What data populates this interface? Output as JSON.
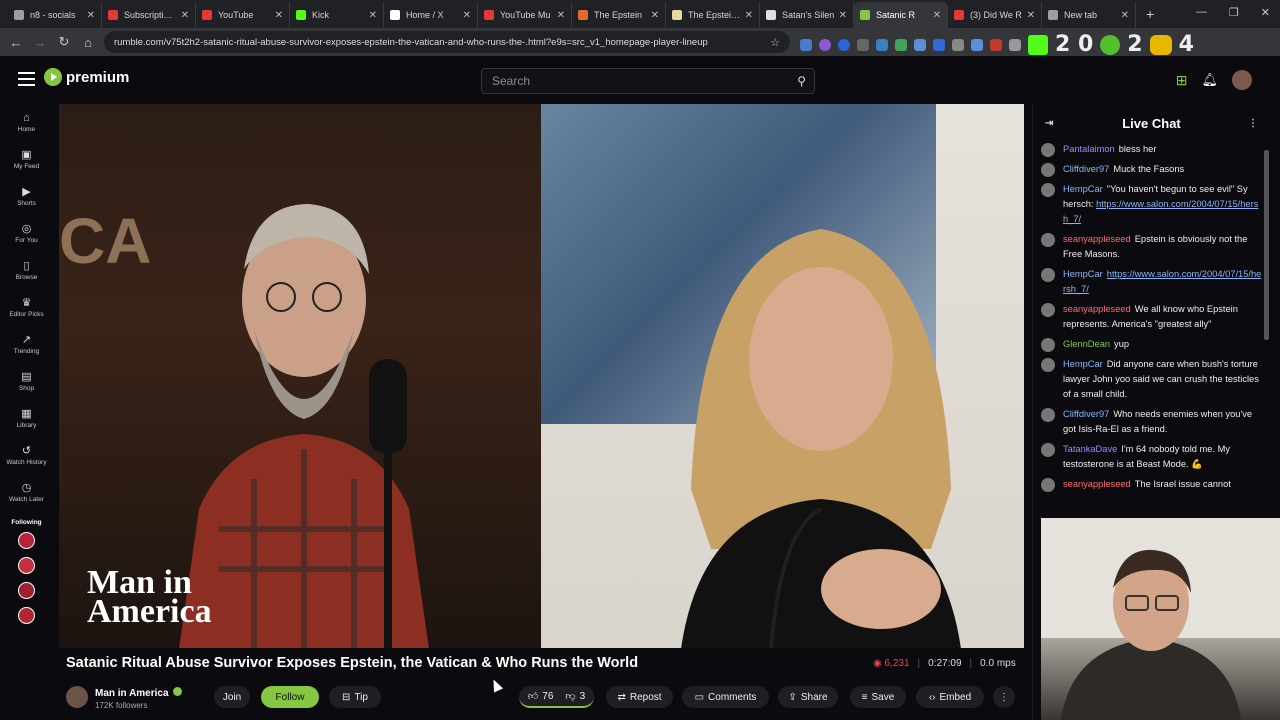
{
  "browser": {
    "tabs": [
      {
        "label": "n8 - socials",
        "color": "#9e9e9e"
      },
      {
        "label": "Subscriptions",
        "color": "#e53935"
      },
      {
        "label": "YouTube",
        "color": "#e53935"
      },
      {
        "label": "Kick",
        "color": "#53fc18"
      },
      {
        "label": "Home / X",
        "color": "#ffffff"
      },
      {
        "label": "YouTube Mu",
        "color": "#e53935"
      },
      {
        "label": "The Epstein",
        "color": "#e86a2a"
      },
      {
        "label": "The Epstein F",
        "color": "#e8d9a0"
      },
      {
        "label": "Satan's Silen",
        "color": "#e0e0e0"
      },
      {
        "label": "Satanic R",
        "color": "#85c742"
      },
      {
        "label": "(3) Did We R",
        "color": "#e53935"
      },
      {
        "label": "New tab",
        "color": "#9e9e9e"
      }
    ],
    "url": "rumble.com/v75t2h2-satanic-ritual-abuse-survivor-exposes-epstein-the-vatican-and-who-runs-the-.html?e9s=src_v1_homepage-player-lineup",
    "ext_text_1": "2 0",
    "ext_text_2": "2",
    "ext_text_3": "4"
  },
  "header": {
    "logo_text": "premium",
    "search_placeholder": "Search"
  },
  "sidebar": {
    "items": [
      {
        "label": "Home",
        "icon": "home-icon",
        "glyph": "⌂"
      },
      {
        "label": "My Feed",
        "icon": "feed-icon",
        "glyph": "▣"
      },
      {
        "label": "Shorts",
        "icon": "shorts-icon",
        "glyph": "▶"
      },
      {
        "label": "For You",
        "icon": "for-you-icon",
        "glyph": "◎"
      },
      {
        "label": "Browse",
        "icon": "browse-icon",
        "glyph": "▯"
      },
      {
        "label": "Editor Picks",
        "icon": "editor-picks-icon",
        "glyph": "♛"
      },
      {
        "label": "Trending",
        "icon": "trending-icon",
        "glyph": "↗"
      },
      {
        "label": "Shop",
        "icon": "shop-icon",
        "glyph": "▤"
      },
      {
        "label": "Library",
        "icon": "library-icon",
        "glyph": "▦"
      },
      {
        "label": "Watch History",
        "icon": "history-icon",
        "glyph": "↺"
      },
      {
        "label": "Watch Later",
        "icon": "clock-icon",
        "glyph": "◷"
      }
    ],
    "following_label": "Following"
  },
  "video": {
    "overlay_text_line1": "Man in",
    "overlay_text_line2": "America",
    "title": "Satanic Ritual Abuse Survivor Exposes Epstein, the Vatican & Who Runs the World",
    "views": "6,231",
    "duration": "0:27:09",
    "mps": "0.0 mps"
  },
  "channel": {
    "name": "Man in America",
    "followers": "172K followers"
  },
  "actions": {
    "join": "Join",
    "follow": "Follow",
    "tip": "Tip",
    "likes": "76",
    "dislikes": "3",
    "repost": "Repost",
    "comments": "Comments",
    "share": "Share",
    "save": "Save",
    "embed": "Embed"
  },
  "chat": {
    "title": "Live Chat",
    "messages": [
      {
        "user": "Pantalaimon",
        "color": "#9a8cff",
        "text": "bless her",
        "link": ""
      },
      {
        "user": "Cliffdiver97",
        "color": "#8ab4f8",
        "text": "Muck the Fasons",
        "link": ""
      },
      {
        "user": "HempCar",
        "color": "#8ab4f8",
        "text": "\"You haven't begun to see evil\" Sy hersch: ",
        "link": "https://www.salon.com/2004/07/15/hersh_7/"
      },
      {
        "user": "seanyappleseed",
        "color": "#ff6b6b",
        "text": "Epstein is obviously not the Free Masons.",
        "link": ""
      },
      {
        "user": "HempCar",
        "color": "#8ab4f8",
        "text": "",
        "link": "https://www.salon.com/2004/07/15/hersh_7/"
      },
      {
        "user": "seanyappleseed",
        "color": "#ff6b6b",
        "text": "We all know who Epstein represents. America's \"greatest ally\"",
        "link": ""
      },
      {
        "user": "GlennDean",
        "color": "#85c742",
        "text": "yup",
        "link": ""
      },
      {
        "user": "HempCar",
        "color": "#8ab4f8",
        "text": "Did anyone care when bush's torture lawyer John yoo said we can crush the testicles of a small child.",
        "link": ""
      },
      {
        "user": "Cliffdiver97",
        "color": "#8ab4f8",
        "text": "Who needs enemies when you've got Isis-Ra-El as a friend.",
        "link": ""
      },
      {
        "user": "TatankaDave",
        "color": "#9a8cff",
        "text": "I'm 64 nobody told me. My testosterone is at Beast Mode. 💪",
        "link": ""
      },
      {
        "user": "seanyappleseed",
        "color": "#ff6b6b",
        "text": "The Israel issue cannot",
        "link": ""
      }
    ]
  }
}
